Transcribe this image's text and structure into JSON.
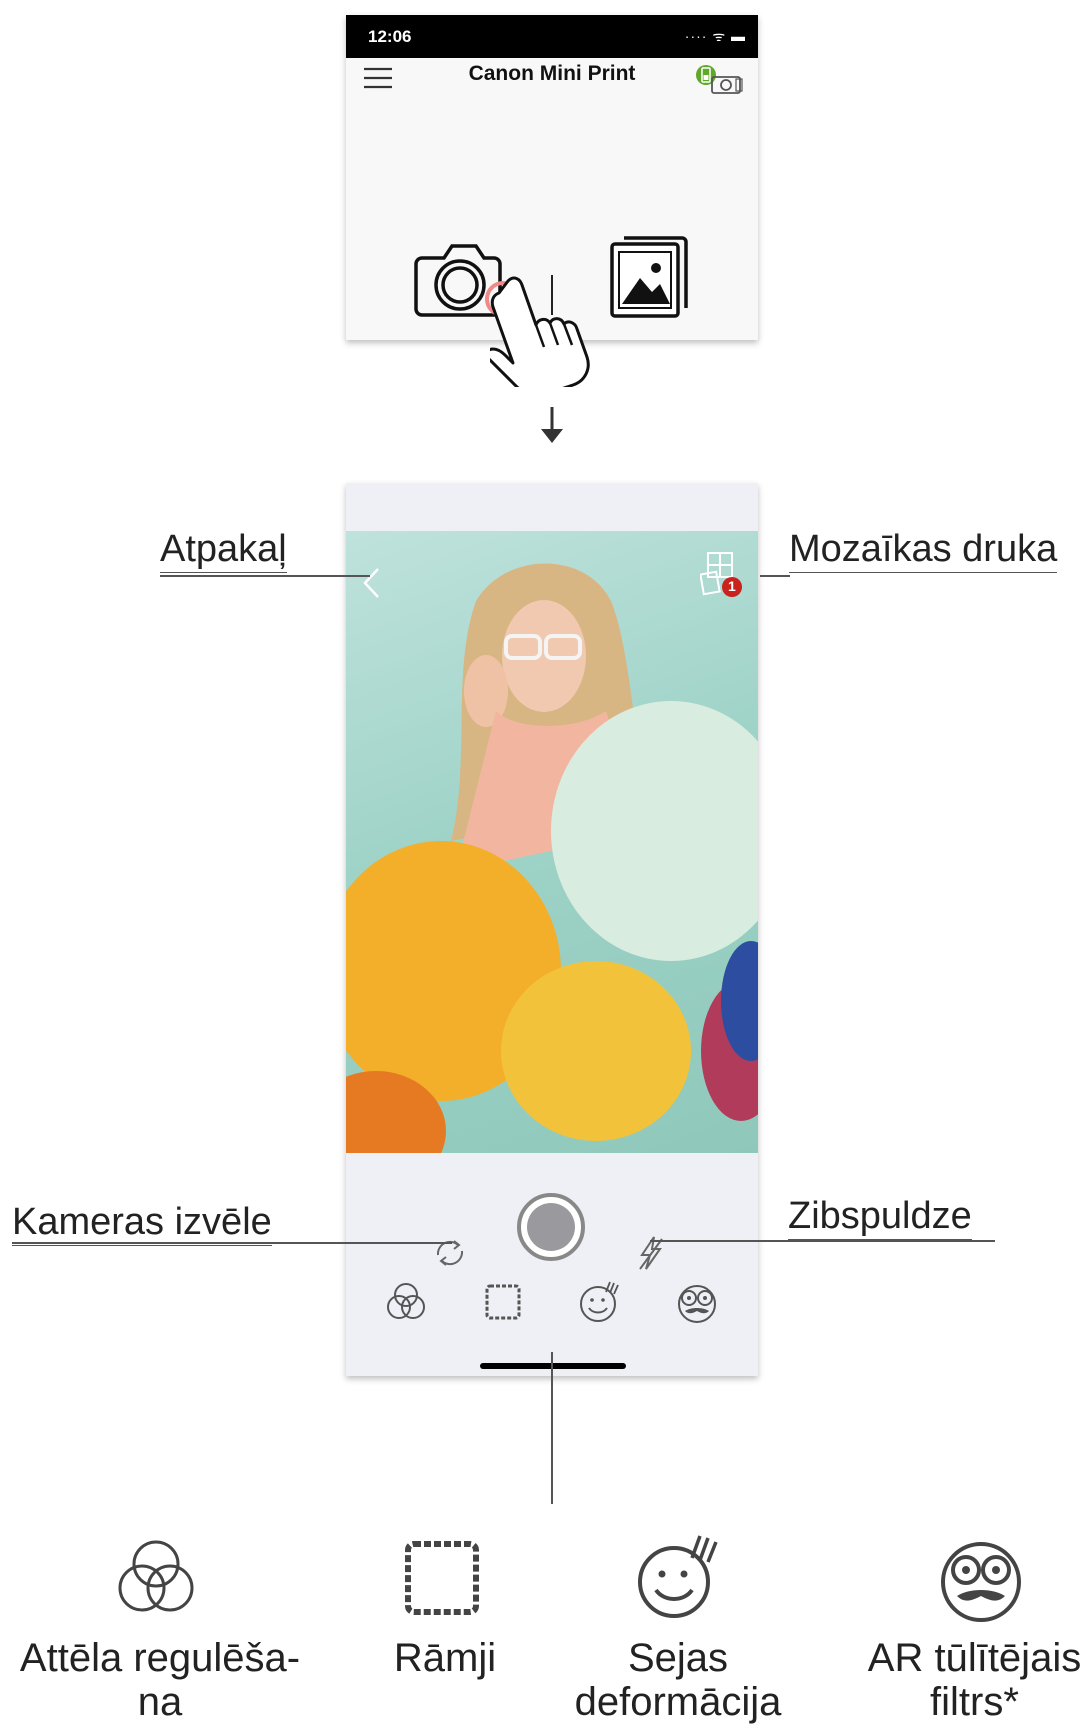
{
  "status_bar": {
    "time": "12:06",
    "indicators": "···· ᯤ ▬"
  },
  "app": {
    "title": "Canon Mini Print"
  },
  "callouts": {
    "back": "Atpakaļ",
    "collage": "Mozaīkas druka",
    "camera_switch": "Kameras izvēle",
    "flash": "Zibspuldze"
  },
  "collage_badge": "1",
  "legend": [
    {
      "label": "Attēla regulēša-\nna",
      "icon": "venn-adjust-icon"
    },
    {
      "label": "Rāmji",
      "icon": "frame-icon"
    },
    {
      "label": "Sejas deformācija",
      "icon": "face-warp-icon"
    },
    {
      "label": "AR tūlītējais filtrs*",
      "icon": "ar-filter-icon"
    }
  ],
  "colors": {
    "tap_ring": "#f08a8a",
    "badge": "#c8231d",
    "printer_battery": "#5fa82a"
  }
}
